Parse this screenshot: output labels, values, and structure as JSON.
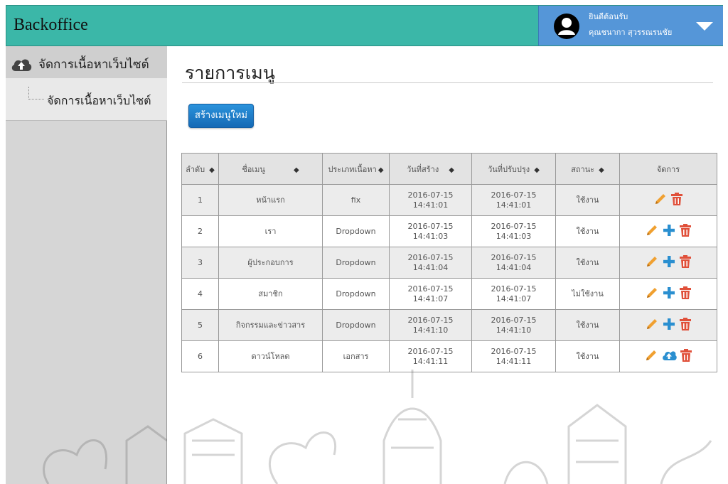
{
  "header": {
    "brand": "Backoffice",
    "welcome": "ยินดีต้อนรับ",
    "username": "คุณชนากา สุวรรณรนชัย",
    "avatar_icon": "user-circle-icon",
    "menu_icon": "caret-down-icon",
    "colors": {
      "bar": "#3bb7a8",
      "user_box": "#5596d8"
    }
  },
  "sidebar": {
    "parent": {
      "icon": "cloud-upload-icon",
      "label": "จัดการเนื้อหาเว็บไซต์"
    },
    "child": {
      "label": "จัดการเนื้อหาเว็บไซต์"
    }
  },
  "main": {
    "title": "รายการเมนู",
    "create_button": "สร้างเมนูใหม่",
    "table": {
      "headers": [
        "ลำดับ",
        "ชื่อเมนู",
        "ประเภทเนื้อหา",
        "วันที่สร้าง",
        "วันที่ปรับปรุง",
        "สถานะ",
        "จัดการ"
      ],
      "rows": [
        {
          "no": "1",
          "name": "หน้าแรก",
          "type": "fix",
          "created": "2016-07-15 14:41:01",
          "updated": "2016-07-15 14:41:01",
          "status": "ใช้งาน",
          "actions": [
            "edit-icon",
            "delete-icon"
          ]
        },
        {
          "no": "2",
          "name": "เรา",
          "type": "Dropdown",
          "created": "2016-07-15 14:41:03",
          "updated": "2016-07-15 14:41:03",
          "status": "ใช้งาน",
          "actions": [
            "edit-icon",
            "add-icon",
            "delete-icon"
          ]
        },
        {
          "no": "3",
          "name": "ผู้ประกอบการ",
          "type": "Dropdown",
          "created": "2016-07-15 14:41:04",
          "updated": "2016-07-15 14:41:04",
          "status": "ใช้งาน",
          "actions": [
            "edit-icon",
            "add-icon",
            "delete-icon"
          ]
        },
        {
          "no": "4",
          "name": "สมาชิก",
          "type": "Dropdown",
          "created": "2016-07-15 14:41:07",
          "updated": "2016-07-15 14:41:07",
          "status": "ไม่ใช้งาน",
          "actions": [
            "edit-icon",
            "add-icon",
            "delete-icon"
          ]
        },
        {
          "no": "5",
          "name": "กิจกรรมและข่าวสาร",
          "type": "Dropdown",
          "created": "2016-07-15 14:41:10",
          "updated": "2016-07-15 14:41:10",
          "status": "ใช้งาน",
          "actions": [
            "edit-icon",
            "add-icon",
            "delete-icon"
          ]
        },
        {
          "no": "6",
          "name": "ดาวน์โหลด",
          "type": "เอกสาร",
          "created": "2016-07-15 14:41:11",
          "updated": "2016-07-15 14:41:11",
          "status": "ใช้งาน",
          "actions": [
            "edit-icon",
            "upload-icon",
            "delete-icon"
          ]
        }
      ]
    },
    "icon_colors": {
      "edit": "#f0a030",
      "add": "#2a8fd0",
      "upload": "#2a8fd0",
      "delete": "#e0503a"
    }
  }
}
